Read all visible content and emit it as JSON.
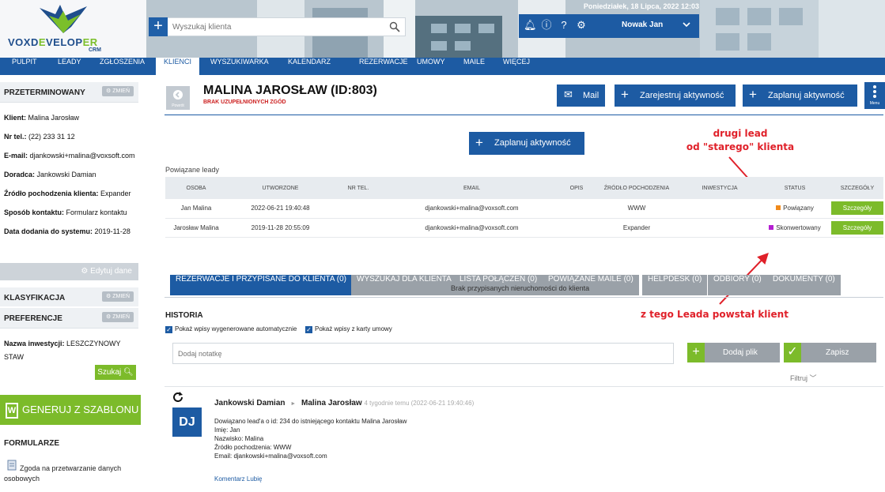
{
  "header": {
    "logo_text": "VOXDEVELOPER",
    "logo_sub": "CRM",
    "search_placeholder": "Wyszukaj klienta",
    "datetime": "Poniedziałek, 18 Lipca, 2022   12:03",
    "user_name": "Nowak Jan"
  },
  "nav": {
    "items": [
      "PULPIT",
      "LEADY",
      "ZGŁOSZENIA",
      "KLIENCI",
      "WYSZUKIWARKA",
      "KALENDARZ",
      "REZERWACJE",
      "UMOWY",
      "MAILE",
      "WIĘCEJ"
    ],
    "active": "KLIENCI"
  },
  "sidebar": {
    "status_title": "PRZETERMINOWANY",
    "change_label": "ZMIEŃ",
    "client_label": "Klient:",
    "client_value": "Malina Jarosław",
    "phone_label": "Nr tel.:",
    "phone_value": "(22) 233 31 12",
    "email_label": "E-mail:",
    "email_value": "djankowski+malina@voxsoft.com",
    "advisor_label": "Doradca:",
    "advisor_value": "Jankowski Damian",
    "source_label": "Źródło pochodzenia klienta:",
    "source_value": "Expander",
    "contact_label": "Sposób kontaktu:",
    "contact_value": "Formularz kontaktu",
    "added_label": "Data dodania do systemu:",
    "added_value": "2019-11-28",
    "edit_label": "Edytuj dane",
    "class_title": "KLASYFIKACJA",
    "pref_title": "PREFERENCJE",
    "invest_label": "Nazwa inwestycji:",
    "invest_value": "LESZCZYNOWY STAW",
    "search_label": "Szukaj",
    "generate_label": "GENERUJ Z SZABLONU",
    "forms_title": "FORMULARZE",
    "form_item": "Zgoda na przetwarzanie danych osobowych"
  },
  "main": {
    "back_label": "Powrót",
    "title": "MALINA JAROSŁAW (ID:803)",
    "warning": "BRAK UZUPEŁNIONYCH ZGÓD",
    "btn_mail": "Mail",
    "btn_register": "Zarejestruj aktywność",
    "btn_plan": "Zaplanuj aktywność",
    "btn_menu": "Menu",
    "center_plan": "Zaplanuj aktywność",
    "annotation_top": "drugi lead\nod \"starego\" klienta",
    "annotation_bottom": "z tego Leada powstał klient",
    "leads_label": "Powiązane leady",
    "table_headers": [
      "OSOBA",
      "UTWORZONE",
      "NR TEL.",
      "EMAIL",
      "OPIS",
      "ŹRÓDŁO POCHODZENIA",
      "INWESTYCJA",
      "STATUS",
      "SZCZEGÓŁY"
    ],
    "rows": [
      {
        "person": "Jan Malina",
        "created": "2022-06-21 19:40:48",
        "phone": "",
        "email": "djankowski+malina@voxsoft.com",
        "desc": "",
        "source": "WWW",
        "investment": "",
        "status": "Powiązany",
        "status_color": "#f08a1c",
        "details": "Szczegóły"
      },
      {
        "person": "Jarosław Malina",
        "created": "2019-11-28 20:55:09",
        "phone": "",
        "email": "djankowski+malina@voxsoft.com",
        "desc": "",
        "source": "Expander",
        "investment": "",
        "status": "Skonwertowany",
        "status_color": "#b41fd1",
        "details": "Szczegóły"
      }
    ],
    "tabs": [
      "REZERWACJE I PRZYPISANE DO KLIENTA (0)",
      "WYSZUKAJ DLA KLIENTA",
      "LISTA POŁĄCZEŃ (0)",
      "POWIĄZANE MAILE (0)",
      "HELPDESK (0)",
      "ODBIORY (0)",
      "DOKUMENTY (0)"
    ],
    "no_properties": "Brak przypisanych nieruchomości do klienta",
    "history_title": "HISTORIA",
    "chk_auto": "Pokaż wpisy wygenerowane automatycznie",
    "chk_contract": "Pokaż wpisy z karty umowy",
    "note_placeholder": "Dodaj notatkę",
    "add_file": "Dodaj plik",
    "save": "Zapisz",
    "filter": "Filtruj"
  },
  "history": {
    "avatar": "DJ",
    "author": "Jankowski Damian",
    "target": "Malina Jarosław",
    "time": "4 tygodnie temu (2022-06-21 19:40:46)",
    "lines": [
      "Dowiązano lead'a o id: 234 do istniejącego kontaktu Malina Jarosław",
      "Imię: Jan",
      "Nazwisko: Malina",
      "Źródło pochodzenia: WWW",
      "Email: djankowski+malina@voxsoft.com"
    ],
    "links": "Komentarz Lubię"
  },
  "colors": {
    "brand_blue": "#1d5ba3",
    "green": "#7cbb2a",
    "annotation_red": "#e0212a"
  }
}
